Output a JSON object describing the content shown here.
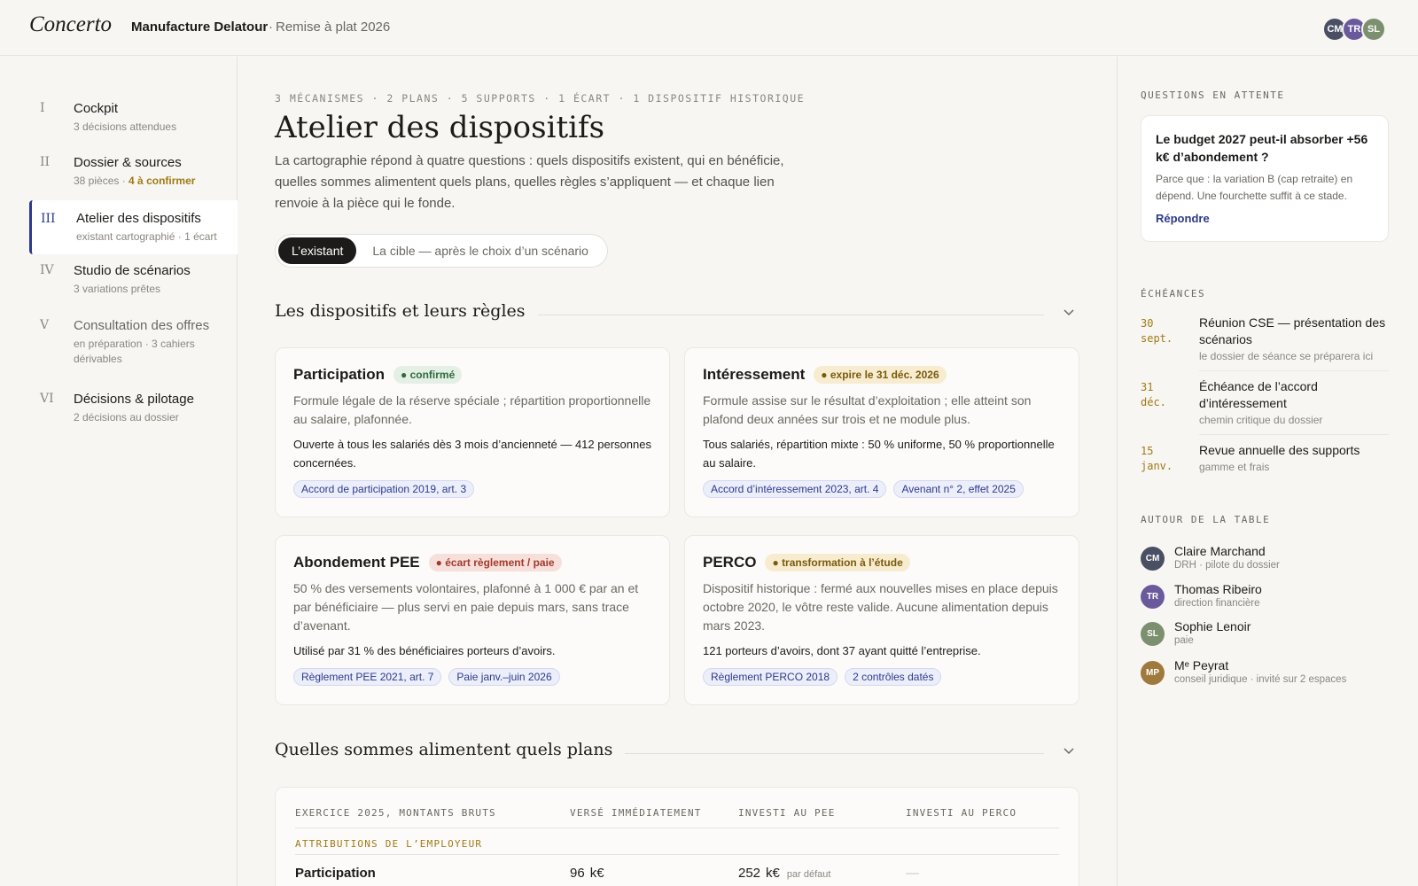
{
  "app": {
    "brand": "Concerto",
    "client": "Manufacture Delatour",
    "project": "Remise à plat 2026",
    "avatars": [
      {
        "initials": "CM",
        "color": "#4a4f63"
      },
      {
        "initials": "TR",
        "color": "#6a5a9c"
      },
      {
        "initials": "SL",
        "color": "#7c8f6e"
      }
    ]
  },
  "nav": [
    {
      "num": "I",
      "title": "Cockpit",
      "sub": "3 décisions attendues"
    },
    {
      "num": "II",
      "title": "Dossier & sources",
      "sub": "38 pièces",
      "sub_warn": "4 à confirmer"
    },
    {
      "num": "III",
      "title": "Atelier des dispositifs",
      "sub": "existant cartographié · 1 écart"
    },
    {
      "num": "IV",
      "title": "Studio de scénarios",
      "sub": "3 variations prêtes"
    },
    {
      "num": "V",
      "title": "Consultation des offres",
      "sub": "en préparation · 3 cahiers dérivables"
    },
    {
      "num": "VI",
      "title": "Décisions & pilotage",
      "sub": "2 décisions au dossier"
    }
  ],
  "main": {
    "eyebrow": "3 MÉCANISMES · 2 PLANS · 5 SUPPORTS · 1 ÉCART · 1 DISPOSITIF HISTORIQUE",
    "title": "Atelier des dispositifs",
    "intro": "La cartographie répond à quatre questions : quels dispositifs existent, qui en bénéficie, quelles sommes alimentent quels plans, quelles règles s’appliquent — et chaque lien renvoie à la pièce qui le fonde.",
    "toggle": {
      "on": "L’existant",
      "off": "La cible — après le choix d’un scénario"
    },
    "section1": "Les dispositifs et leurs règles",
    "section2": "Quelles sommes alimentent quels plans",
    "cards": [
      {
        "name": "Participation",
        "badge": "confirmé",
        "desc": "Formule légale de la réserve spéciale ; répartition proportionnelle au salaire, plafonnée.",
        "fact": "Ouverte à tous les salariés dès 3 mois d’ancienneté — 412 personnes concernées.",
        "tags": [
          "Accord de participation 2019, art. 3"
        ]
      },
      {
        "name": "Intéressement",
        "badge": "expire le 31 déc. 2026",
        "desc": "Formule assise sur le résultat d’exploitation ; elle atteint son plafond deux années sur trois et ne module plus.",
        "fact": "Tous salariés, répartition mixte : 50 % uniforme, 50 % proportionnelle au salaire.",
        "tags": [
          "Accord d’intéressement 2023, art. 4",
          "Avenant n° 2, effet 2025"
        ]
      },
      {
        "name": "Abondement PEE",
        "badge": "écart règlement / paie",
        "desc": "50 % des versements volontaires, plafonné à 1 000 € par an et par bénéficiaire — plus servi en paie depuis mars, sans trace d’avenant.",
        "fact": "Utilisé par 31 % des bénéficiaires porteurs d’avoirs.",
        "tags": [
          "Règlement PEE 2021, art. 7",
          "Paie janv.–juin 2026"
        ]
      },
      {
        "name": "PERCO",
        "badge": "transformation à l’étude",
        "desc": "Dispositif historique : fermé aux nouvelles mises en place depuis octobre 2020, le vôtre reste valide. Aucune alimentation depuis mars 2023.",
        "fact": "121 porteurs d’avoirs, dont 37 ayant quitté l’entreprise.",
        "tags": [
          "Règlement PERCO 2018",
          "2 contrôles datés"
        ]
      }
    ],
    "table": {
      "headers": [
        "EXERCICE 2025, MONTANTS BRUTS",
        "VERSÉ IMMÉDIATEMENT",
        "INVESTI AU PEE",
        "INVESTI AU PERCO"
      ],
      "group": "ATTRIBUTIONS DE L’EMPLOYEUR",
      "row": {
        "label": "Participation",
        "verse": "96",
        "verse_unit": "k€",
        "pee": "252",
        "pee_unit": "k€",
        "pee_note": "par défaut",
        "perco": "—"
      }
    }
  },
  "right": {
    "questions_title": "QUESTIONS EN ATTENTE",
    "question": "Le budget 2027 peut-il absorber +56 k€ d’abondement ?",
    "why": "Parce que : la variation B (cap retraite) en dépend. Une fourchette suffit à ce stade.",
    "answer": "Répondre",
    "deadlines_title": "ÉCHÉANCES",
    "deadlines": [
      {
        "date": "30 sept.",
        "title": "Réunion CSE — présentation des scénarios",
        "sub": "le dossier de séance se préparera ici"
      },
      {
        "date": "31 déc.",
        "title": "Échéance de l’accord d’intéressement",
        "sub": "chemin critique du dossier"
      },
      {
        "date": "15 janv.",
        "title": "Revue annuelle des supports",
        "sub": "gamme et frais"
      }
    ],
    "people_title": "AUTOUR DE LA TABLE",
    "people": [
      {
        "initials": "CM",
        "name": "Claire Marchand",
        "role": "DRH · pilote du dossier",
        "color": "#4a4f63"
      },
      {
        "initials": "TR",
        "name": "Thomas Ribeiro",
        "role": "direction financière",
        "color": "#6a5a9c"
      },
      {
        "initials": "SL",
        "name": "Sophie Lenoir",
        "role": "paie",
        "color": "#7c8f6e"
      },
      {
        "initials": "MP",
        "name": "Mᵉ Peyrat",
        "role": "conseil juridique · invité sur 2 espaces",
        "color": "#a07a3c"
      }
    ]
  }
}
